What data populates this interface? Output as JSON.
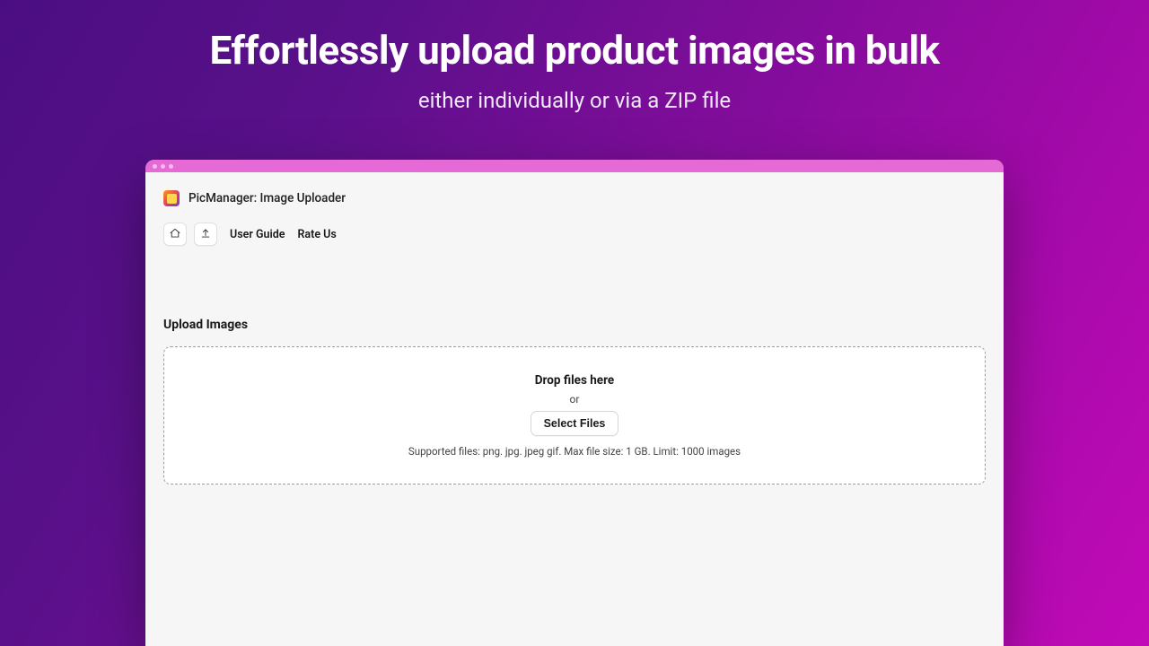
{
  "hero": {
    "title": "Effortlessly upload product images in bulk",
    "subtitle": "either individually or via a ZIP file"
  },
  "app": {
    "title": "PicManager: Image Uploader"
  },
  "toolbar": {
    "user_guide": "User Guide",
    "rate_us": "Rate Us"
  },
  "upload": {
    "section_title": "Upload Images",
    "drop_label": "Drop files here",
    "or_label": "or",
    "select_label": "Select Files",
    "hint": "Supported files: png. jpg. jpeg gif. Max file size: 1 GB. Limit: 1000 images"
  }
}
